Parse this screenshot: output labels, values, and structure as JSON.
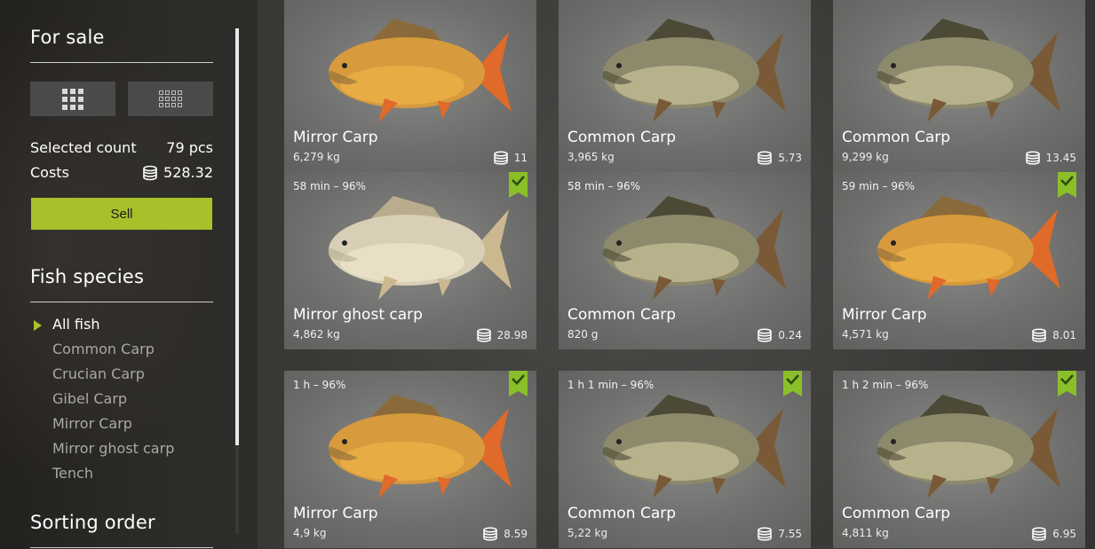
{
  "sidebar": {
    "for_sale_title": "For sale",
    "selected_count_label": "Selected count",
    "selected_count_value": "79 pcs",
    "costs_label": "Costs",
    "costs_value": "528.32",
    "sell_label": "Sell",
    "fish_species_title": "Fish species",
    "species": [
      "All fish",
      "Common Carp",
      "Crucian Carp",
      "Gibel Carp",
      "Mirror Carp",
      "Mirror ghost carp",
      "Tench"
    ],
    "active_species": "All fish",
    "sorting_title": "Sorting order"
  },
  "colors": {
    "accent": "#a8c12a",
    "card_bg": "#6f6f6d"
  },
  "cards": [
    {
      "time": "",
      "name": "Mirror Carp",
      "weight": "6,279 kg",
      "price": "11",
      "checked": false,
      "kind": "mirror"
    },
    {
      "time": "",
      "name": "Common Carp",
      "weight": "3,965 kg",
      "price": "5.73",
      "checked": false,
      "kind": "common"
    },
    {
      "time": "",
      "name": "Common Carp",
      "weight": "9,299 kg",
      "price": "13.45",
      "checked": false,
      "kind": "common"
    },
    {
      "time": "58 min – 96%",
      "name": "Mirror ghost carp",
      "weight": "4,862 kg",
      "price": "28.98",
      "checked": true,
      "kind": "ghost"
    },
    {
      "time": "58 min – 96%",
      "name": "Common Carp",
      "weight": "820 g",
      "price": "0.24",
      "checked": false,
      "kind": "common"
    },
    {
      "time": "59 min – 96%",
      "name": "Mirror Carp",
      "weight": "4,571 kg",
      "price": "8.01",
      "checked": true,
      "kind": "mirror"
    },
    {
      "time": "1 h – 96%",
      "name": "Mirror Carp",
      "weight": "4,9 kg",
      "price": "8.59",
      "checked": true,
      "kind": "mirror"
    },
    {
      "time": "1 h 1 min – 96%",
      "name": "Common Carp",
      "weight": "5,22 kg",
      "price": "7.55",
      "checked": true,
      "kind": "common"
    },
    {
      "time": "1 h 2 min – 96%",
      "name": "Common Carp",
      "weight": "4,811 kg",
      "price": "6.95",
      "checked": true,
      "kind": "common"
    }
  ]
}
